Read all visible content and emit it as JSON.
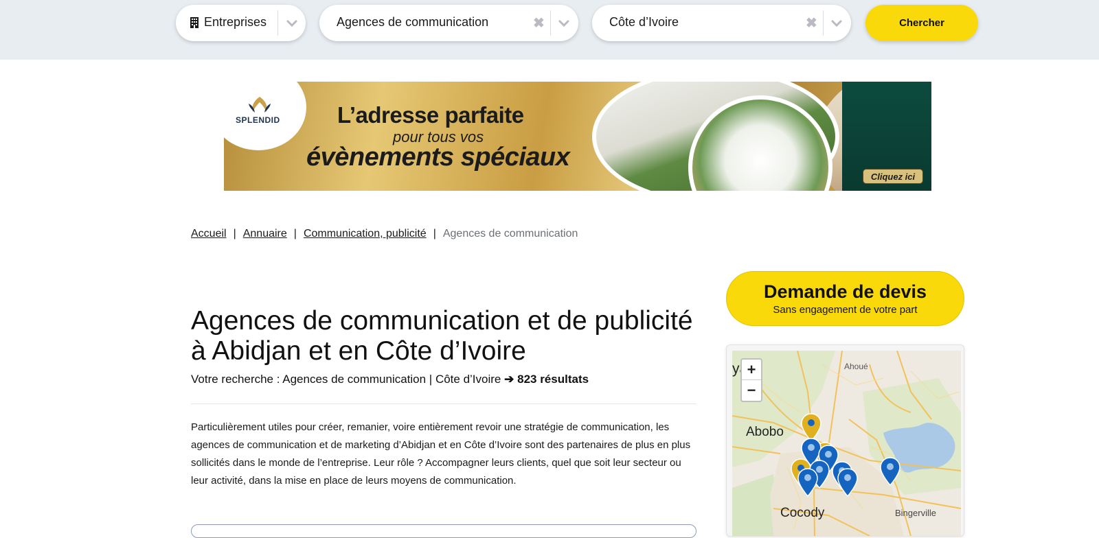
{
  "search": {
    "type_value": "Entreprises",
    "category_value": "Agences de communication",
    "location_value": "Côte d’Ivoire",
    "clear_glyph": "✖",
    "submit_label": "Chercher"
  },
  "banner": {
    "brand": "SPLENDID",
    "line1": "L’adresse parfaite",
    "line2": "pour tous vos",
    "line3": "évènements spéciaux",
    "cta": "Cliquez ici"
  },
  "breadcrumb": {
    "items": [
      "Accueil",
      "Annuaire",
      "Communication, publicité"
    ],
    "current": "Agences de communication",
    "separator": "|"
  },
  "main": {
    "title": "Agences de communication et de publicité à Abidjan et en Côte d’Ivoire",
    "summary_prefix": "Votre recherche : Agences de communication | Côte d’Ivoire",
    "summary_arrow": "➔",
    "summary_count": "823 résultats",
    "intro": "Particulièrement utiles pour créer, remanier, voire entièrement revoir une stratégie de communication, les agences de communication et de marketing d’Abidjan et en Côte d’Ivoire sont des partenaires de plus en plus sollicités dans le monde de l’entreprise. Leur rôle ? Accompagner leurs clients, quel que soit leur secteur ou leur activité, dans la mise en place de leurs moyens de communication."
  },
  "sidebar": {
    "quote_title": "Demande de devis",
    "quote_subtitle": "Sans engagement de votre part",
    "map": {
      "zoom_in": "+",
      "zoom_out": "−",
      "labels": [
        "ya",
        "Ahoué",
        "Abobo",
        "Cocody",
        "Bingerville"
      ]
    }
  },
  "colors": {
    "accent_yellow": "#f9d90a",
    "marker_blue": "#1565c0",
    "marker_gold": "#e0b020",
    "search_strip": "#e8edf2"
  }
}
